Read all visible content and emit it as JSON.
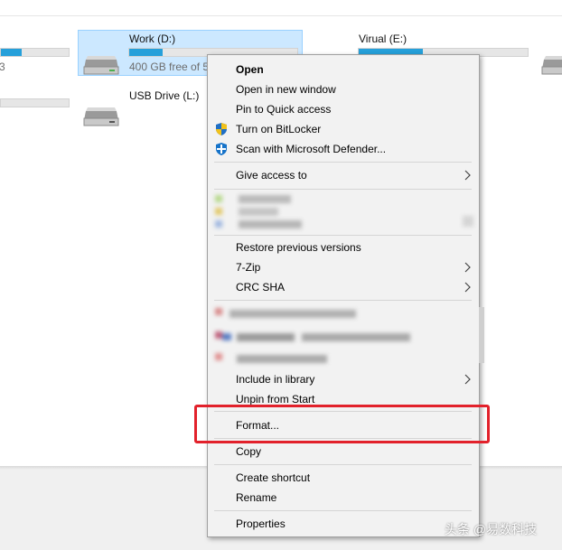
{
  "drives": {
    "left_partial_1": {
      "free_text": "3",
      "fill_fraction": 0.3
    },
    "left_partial_2": {
      "fill_fraction": 0.0
    },
    "work": {
      "name": "Work (D:)",
      "free_text": "400 GB free of 50",
      "fill_fraction": 0.2
    },
    "usb": {
      "name": "USB Drive (L:)"
    },
    "virtual": {
      "name": "Virual (E:)",
      "fill_fraction": 0.38
    }
  },
  "menu": {
    "items": [
      {
        "label": "Open",
        "bold": true
      },
      {
        "label": "Open in new window"
      },
      {
        "label": "Pin to Quick access"
      },
      {
        "label": "Turn on BitLocker",
        "icon": "shield-icon"
      },
      {
        "label": "Scan with Microsoft Defender...",
        "icon": "defender-icon"
      },
      {
        "label": "Give access to",
        "submenu": true
      },
      {
        "label": "Restore previous versions"
      },
      {
        "label": "7-Zip",
        "submenu": true
      },
      {
        "label": "CRC SHA",
        "submenu": true
      },
      {
        "label": "Include in library",
        "submenu": true
      },
      {
        "label": "Unpin from Start"
      },
      {
        "label": "Format..."
      },
      {
        "label": "Copy"
      },
      {
        "label": "Create shortcut"
      },
      {
        "label": "Rename"
      },
      {
        "label": "Properties"
      }
    ]
  },
  "watermark": "头条 @易数科技",
  "colors": {
    "accent": "#26a0da",
    "selection": "#cce8ff",
    "highlight_box": "#e2212b"
  }
}
